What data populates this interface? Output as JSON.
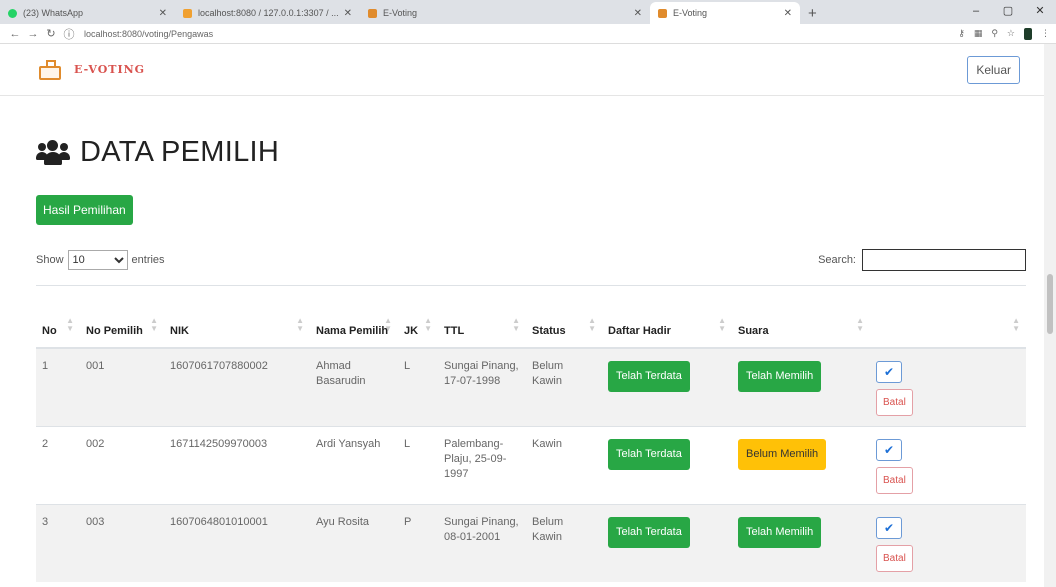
{
  "browser": {
    "tabs": [
      {
        "label": "(23) WhatsApp",
        "favicon_color": "#25d366"
      },
      {
        "label": "localhost:8080 / 127.0.0.1:3307 / ...",
        "favicon_color": "#f0a030"
      },
      {
        "label": "E-Voting",
        "favicon_color": "#e08b2c"
      },
      {
        "label": "E-Voting",
        "favicon_color": "#e08b2c"
      }
    ],
    "url": "localhost:8080/voting/Pengawas",
    "window_controls": [
      "–",
      "▢",
      "✕"
    ]
  },
  "nav": {
    "brand": "E-VOTING",
    "logout_label": "Keluar"
  },
  "page": {
    "title": "DATA PEMILIH",
    "results_button": "Hasil Pemilihan",
    "show_label": "Show",
    "entries_value": "10",
    "entries_label": "entries",
    "search_label": "Search:"
  },
  "table": {
    "headers": [
      "No",
      "No Pemilih",
      "NIK",
      "Nama Pemilih",
      "JK",
      "TTL",
      "Status",
      "Daftar Hadir",
      "Suara",
      ""
    ],
    "rows": [
      {
        "no": "1",
        "no_pemilih": "001",
        "nik": "1607061707880002",
        "nama": "Ahmad Basarudin",
        "jk": "L",
        "ttl": "Sungai Pinang, 17-07-1998",
        "status": "Belum Kawin",
        "hadir": "Telah Terdata",
        "suara": "Telah Memilih",
        "suara_state": "done",
        "batal": "Batal"
      },
      {
        "no": "2",
        "no_pemilih": "002",
        "nik": "1671142509970003",
        "nama": "Ardi Yansyah",
        "jk": "L",
        "ttl": "Palembang-Plaju, 25-09-1997",
        "status": "Kawin",
        "hadir": "Telah Terdata",
        "suara": "Belum Memilih",
        "suara_state": "pending",
        "batal": "Batal"
      },
      {
        "no": "3",
        "no_pemilih": "003",
        "nik": "1607064801010001",
        "nama": "Ayu Rosita",
        "jk": "P",
        "ttl": "Sungai Pinang, 08-01-2001",
        "status": "Belum Kawin",
        "hadir": "Telah Terdata",
        "suara": "Telah Memilih",
        "suara_state": "done",
        "batal": "Batal"
      }
    ]
  },
  "colors": {
    "success": "#28a745",
    "warning": "#ffc107",
    "brand": "#d9534f"
  }
}
